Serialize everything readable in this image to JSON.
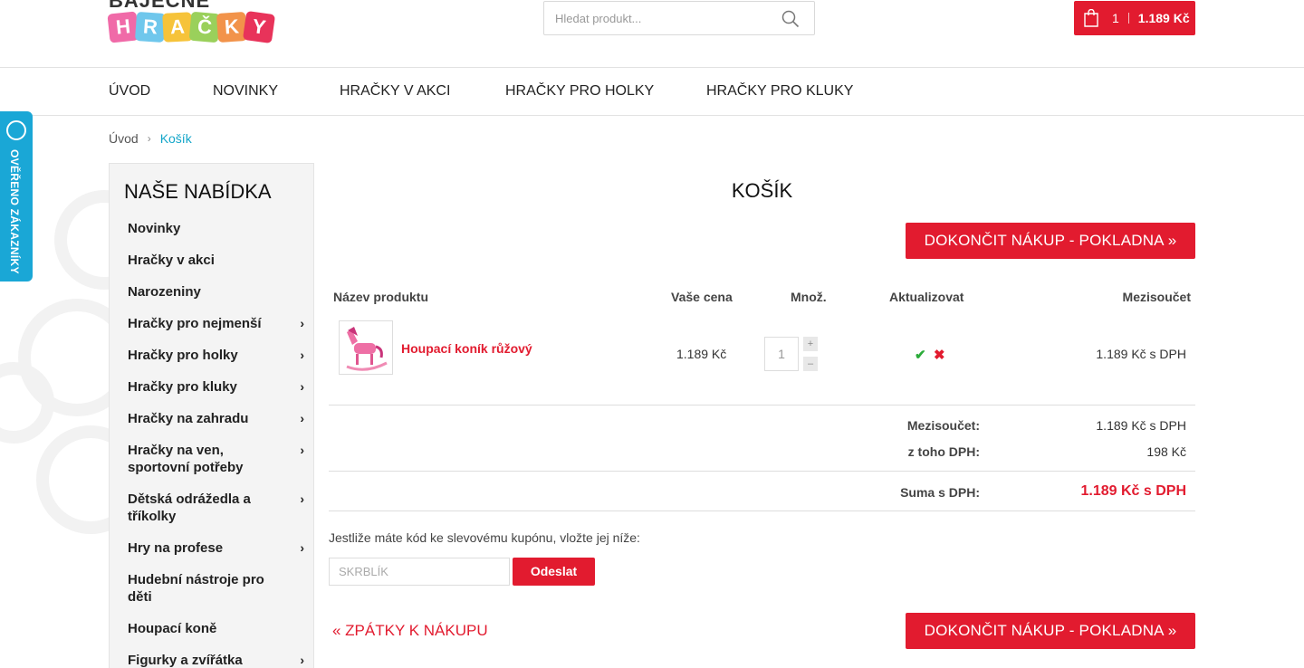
{
  "brand": {
    "top": "BÁJEČNÉ",
    "letters": [
      "H",
      "R",
      "A",
      "Č",
      "K",
      "Y"
    ],
    "colors": [
      "#f06aa8",
      "#6fc7ec",
      "#f6c33a",
      "#9ad05b",
      "#f2934a",
      "#e8335a"
    ]
  },
  "search": {
    "placeholder": "Hledat produkt..."
  },
  "cart": {
    "count": "1",
    "total": "1.189 Kč"
  },
  "nav": [
    {
      "label": "ÚVOD"
    },
    {
      "label": "NOVINKY"
    },
    {
      "label": "HRAČKY V AKCI"
    },
    {
      "label": "HRAČKY PRO HOLKY"
    },
    {
      "label": "HRAČKY PRO KLUKY"
    }
  ],
  "verified": {
    "label": "OVĚŘENO ZÁKAZNÍKY"
  },
  "breadcrumb": {
    "home": "Úvod",
    "separator": "›",
    "current": "Košík"
  },
  "sidebar": {
    "title": "NAŠE NABÍDKA",
    "items": [
      {
        "label": "Novinky",
        "arrow": ""
      },
      {
        "label": "Hračky v akci",
        "arrow": ""
      },
      {
        "label": "Narozeniny",
        "arrow": ""
      },
      {
        "label": "Hračky pro nejmenší",
        "arrow": "›"
      },
      {
        "label": "Hračky pro holky",
        "arrow": "›"
      },
      {
        "label": "Hračky pro kluky",
        "arrow": "›"
      },
      {
        "label": "Hračky na zahradu",
        "arrow": "›"
      },
      {
        "label": "Hračky na ven, sportovní potřeby",
        "arrow": "›"
      },
      {
        "label": "Dětská odrážedla a tříkolky",
        "arrow": "›"
      },
      {
        "label": "Hry na profese",
        "arrow": "›"
      },
      {
        "label": "Hudební nástroje pro děti",
        "arrow": ""
      },
      {
        "label": "Houpací koně",
        "arrow": ""
      },
      {
        "label": "Figurky a zvířátka",
        "arrow": "›"
      }
    ]
  },
  "cart_page": {
    "title": "KOŠÍK",
    "checkout_label": "DOKONČIT NÁKUP - POKLADNA »",
    "headers": {
      "product": "Název produktu",
      "price": "Vaše cena",
      "qty": "Množ.",
      "update": "Aktualizovat",
      "subtotal": "Mezisoučet"
    },
    "item": {
      "name": "Houpací koník růžový",
      "price": "1.189 Kč",
      "qty": "1",
      "qty_plus": "+",
      "qty_minus": "–",
      "update_ok": "✔",
      "update_delete": "✖",
      "subtotal": "1.189 Kč s DPH"
    },
    "summary": {
      "subtotal_label": "Mezisoučet:",
      "subtotal_value": "1.189 Kč s DPH",
      "vat_label": "z toho DPH:",
      "vat_value": "198 Kč",
      "total_label": "Suma s DPH:",
      "total_value": "1.189 Kč s DPH"
    },
    "coupon": {
      "text": "Jestliže máte kód ke slevovému kupónu, vložte jej níže:",
      "placeholder": "SKRBLÍK",
      "button": "Odeslat"
    },
    "back_label": "« ZPÁTKY K NÁKUPU"
  },
  "colors": {
    "accent_red": "#e21b2f",
    "link_blue": "#13a6c9",
    "verified_blue": "#1aa7d6",
    "ok_green": "#2bab3a"
  }
}
